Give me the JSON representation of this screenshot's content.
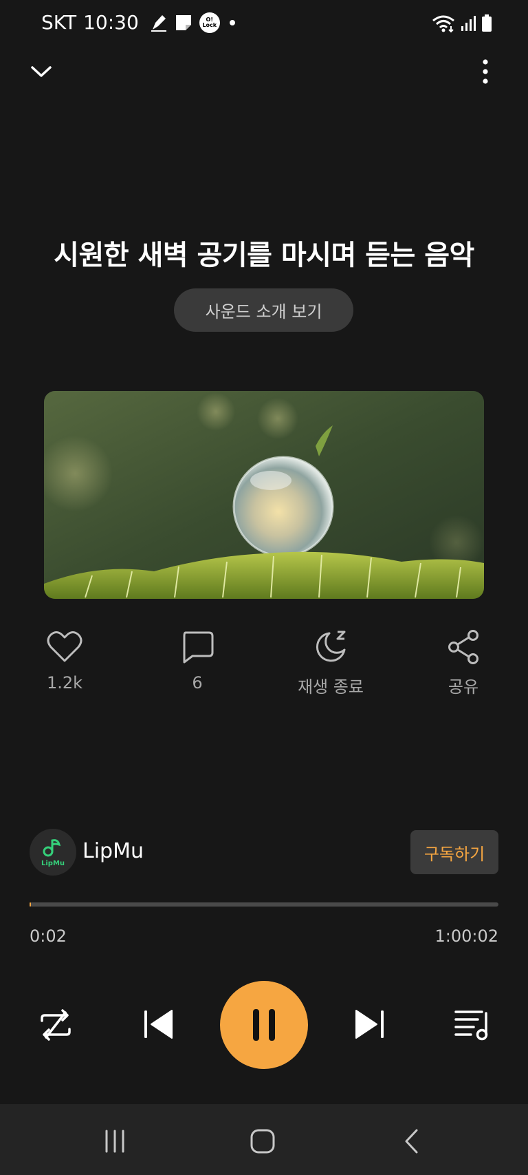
{
  "status_bar": {
    "carrier": "SKT",
    "time": "10:30",
    "icons_left": [
      "pen-icon",
      "notes-icon",
      "oclock-icon",
      "dot-icon"
    ],
    "icons_right": [
      "wifi-icon",
      "signal-icon",
      "battery-icon"
    ],
    "oclock_badge": "O! Lock"
  },
  "header": {
    "collapse_icon": "chevron-down-icon",
    "more_icon": "more-vertical-icon"
  },
  "track": {
    "title": "시원한 새벽 공기를 마시며 듣는 음악",
    "intro_button": "사운드 소개 보기",
    "thumbnail": "dew-drop-on-moss-image"
  },
  "actions": [
    {
      "icon": "heart-icon",
      "label": "1.2k"
    },
    {
      "icon": "comment-icon",
      "label": "6"
    },
    {
      "icon": "sleep-timer-icon",
      "label": "재생 종료"
    },
    {
      "icon": "share-icon",
      "label": "공유"
    }
  ],
  "channel": {
    "name": "LipMu",
    "logo_text": "LipMu",
    "subscribe_label": "구독하기"
  },
  "player": {
    "current_time": "0:02",
    "total_time": "1:00:02",
    "progress_fraction": 0.0006,
    "accent_color": "#f6a641",
    "controls": [
      "repeat-icon",
      "previous-icon",
      "pause-icon",
      "next-icon",
      "playlist-icon"
    ]
  },
  "nav_bar": {
    "buttons": [
      "recent-apps-icon",
      "home-icon",
      "back-icon"
    ]
  }
}
